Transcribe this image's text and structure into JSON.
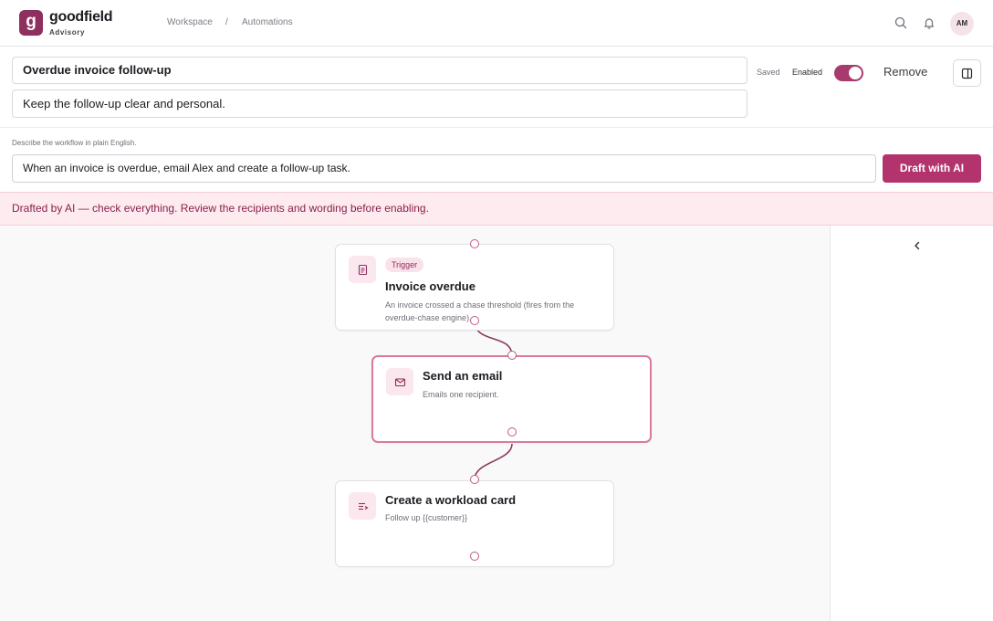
{
  "brand": {
    "logo_letter": "g",
    "name": "goodfield",
    "sub": "Advisory"
  },
  "breadcrumb": {
    "workspace": "Workspace",
    "separator": "/",
    "automations": "Automations"
  },
  "header": {
    "avatar_initials": "AM",
    "icons": [
      "search-icon",
      "bell-icon"
    ]
  },
  "automation": {
    "title": "Overdue invoice follow-up",
    "description": "Keep the follow-up clear and personal.",
    "saved_label": "Saved",
    "enabled_label": "Enabled",
    "enabled": true,
    "remove_label": "Remove"
  },
  "prompt": {
    "label": "Describe the workflow in plain English.",
    "value": "When an invoice is overdue, email Alex and create a follow-up task.",
    "button_label": "Draft with AI"
  },
  "banner": {
    "text": "Drafted by AI — check everything. Review the recipients and wording before enabling."
  },
  "nodes": [
    {
      "tag": "Trigger",
      "title": "Invoice overdue",
      "description": "An invoice crossed a chase threshold (fires from the overdue-chase engine).",
      "icon": "document-icon"
    },
    {
      "title": "Send an email",
      "description": "Emails one recipient.",
      "icon": "mail-icon",
      "selected": true
    },
    {
      "title": "Create a workload card",
      "description": "Follow up {{customer}}",
      "icon": "list-add-icon"
    }
  ],
  "colors": {
    "accent": "#b3336d",
    "brand": "#8e2f5d",
    "banner_bg": "#fdebf0",
    "banner_text": "#8c1f4b"
  }
}
